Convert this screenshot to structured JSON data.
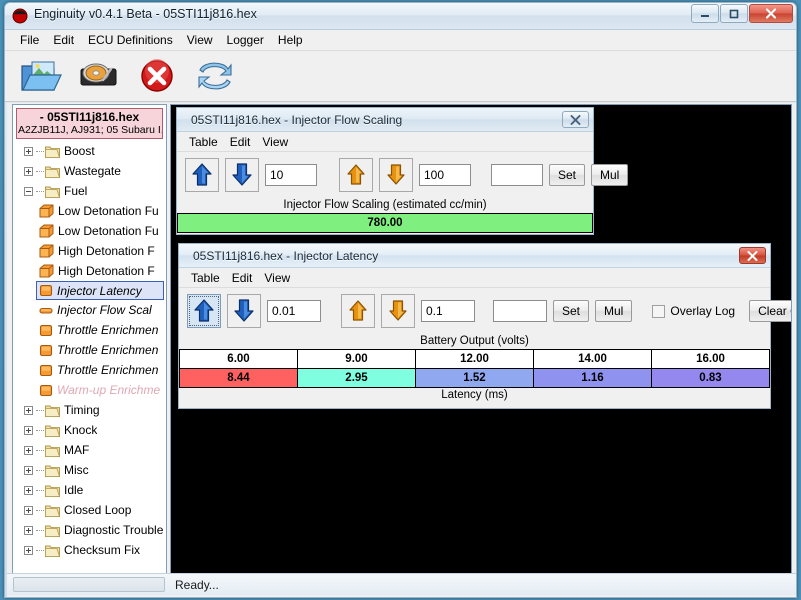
{
  "window": {
    "title": "Enginuity v0.4.1 Beta - 05STI11j816.hex",
    "app_icon": "enginuity-logo-icon",
    "minimize_label": "Minimize",
    "maximize_label": "Maximize",
    "close_label": "Close"
  },
  "menubar": {
    "items": [
      {
        "label": "File"
      },
      {
        "label": "Edit"
      },
      {
        "label": "ECU Definitions"
      },
      {
        "label": "View"
      },
      {
        "label": "Logger"
      },
      {
        "label": "Help"
      }
    ]
  },
  "toolbar": {
    "buttons": [
      {
        "name": "open-image-icon",
        "tooltip": "Open Image"
      },
      {
        "name": "save-image-icon",
        "tooltip": "Save Image"
      },
      {
        "name": "close-image-icon",
        "tooltip": "Close Image"
      },
      {
        "name": "refresh-icon",
        "tooltip": "Refresh"
      }
    ]
  },
  "tree": {
    "file_name": "- 05STI11j816.hex",
    "file_desc": "A2ZJB11J, AJ931; 05 Subaru I...",
    "nodes": [
      {
        "label": "Boost",
        "type": "folder",
        "expander": "plus",
        "depth": 0
      },
      {
        "label": "Wastegate",
        "type": "folder",
        "expander": "plus",
        "depth": 0
      },
      {
        "label": "Fuel",
        "type": "folder",
        "expander": "minus",
        "depth": 0
      },
      {
        "label": "Low Detonation Fu",
        "type": "table3d",
        "depth": 1,
        "italic": false
      },
      {
        "label": "Low Detonation Fu",
        "type": "table3d",
        "depth": 1,
        "italic": false
      },
      {
        "label": "High Detonation F",
        "type": "table3d",
        "depth": 1,
        "italic": false
      },
      {
        "label": "High Detonation F",
        "type": "table3d",
        "depth": 1,
        "italic": false
      },
      {
        "label": "Injector Latency",
        "type": "table2d",
        "depth": 1,
        "selected": true,
        "italic": true
      },
      {
        "label": "Injector Flow Scal",
        "type": "table1d",
        "depth": 1,
        "italic": true
      },
      {
        "label": "Throttle Enrichmen",
        "type": "table2d",
        "depth": 1,
        "italic": true
      },
      {
        "label": "Throttle Enrichmen",
        "type": "table2d",
        "depth": 1,
        "italic": true
      },
      {
        "label": "Throttle Enrichmen",
        "type": "table2d",
        "depth": 1,
        "italic": true
      },
      {
        "label": "Warm-up Enrichme",
        "type": "table2d",
        "depth": 1,
        "italic": true,
        "disabled": true
      },
      {
        "label": "Timing",
        "type": "folder",
        "expander": "plus",
        "depth": 0
      },
      {
        "label": "Knock",
        "type": "folder",
        "expander": "plus",
        "depth": 0
      },
      {
        "label": "MAF",
        "type": "folder",
        "expander": "plus",
        "depth": 0
      },
      {
        "label": "Misc",
        "type": "folder",
        "expander": "plus",
        "depth": 0
      },
      {
        "label": "Idle",
        "type": "folder",
        "expander": "plus",
        "depth": 0
      },
      {
        "label": "Closed Loop",
        "type": "folder",
        "expander": "plus",
        "depth": 0
      },
      {
        "label": "Diagnostic Trouble Coc",
        "type": "folder",
        "expander": "plus",
        "depth": 0
      },
      {
        "label": "Checksum Fix",
        "type": "folder",
        "expander": "plus",
        "depth": 0
      }
    ],
    "hscroll": {
      "thumb_glyph": "III",
      "left_arrow": "◀",
      "right_arrow": "▶"
    }
  },
  "flow_window": {
    "title": "05STI11j816.hex - Injector Flow Scaling",
    "close_label": "Close",
    "menu": [
      {
        "label": "Table"
      },
      {
        "label": "Edit"
      },
      {
        "label": "View"
      }
    ],
    "coarse_value": "10",
    "fine_value": "100",
    "set_value": "",
    "set_label": "Set",
    "mul_label": "Mul",
    "axis_label": "Injector Flow Scaling (estimated cc/min)",
    "cell_value": "780.00",
    "cell_color": "#7FEF7F"
  },
  "latency_window": {
    "title": "05STI11j816.hex - Injector Latency",
    "close_label": "Close",
    "menu": [
      {
        "label": "Table"
      },
      {
        "label": "Edit"
      },
      {
        "label": "View"
      }
    ],
    "coarse_value": "0.01",
    "fine_value": "0.1",
    "set_value": "",
    "set_label": "Set",
    "mul_label": "Mul",
    "overlay_log_label": "Overlay Log",
    "overlay_log_checked": false,
    "clear_overlay_label": "Clear Overlay",
    "x_axis_label": "Battery Output (volts)",
    "y_axis_label": "Latency (ms)",
    "headers": [
      "6.00",
      "9.00",
      "12.00",
      "14.00",
      "16.00"
    ],
    "values": [
      "8.44",
      "2.95",
      "1.52",
      "1.16",
      "0.83"
    ],
    "value_colors": [
      "#FF6060",
      "#7FFFE0",
      "#8FA8F0",
      "#8F92EE",
      "#9488EE"
    ]
  },
  "statusbar": {
    "text": "Ready...",
    "progress_percent": 0
  }
}
